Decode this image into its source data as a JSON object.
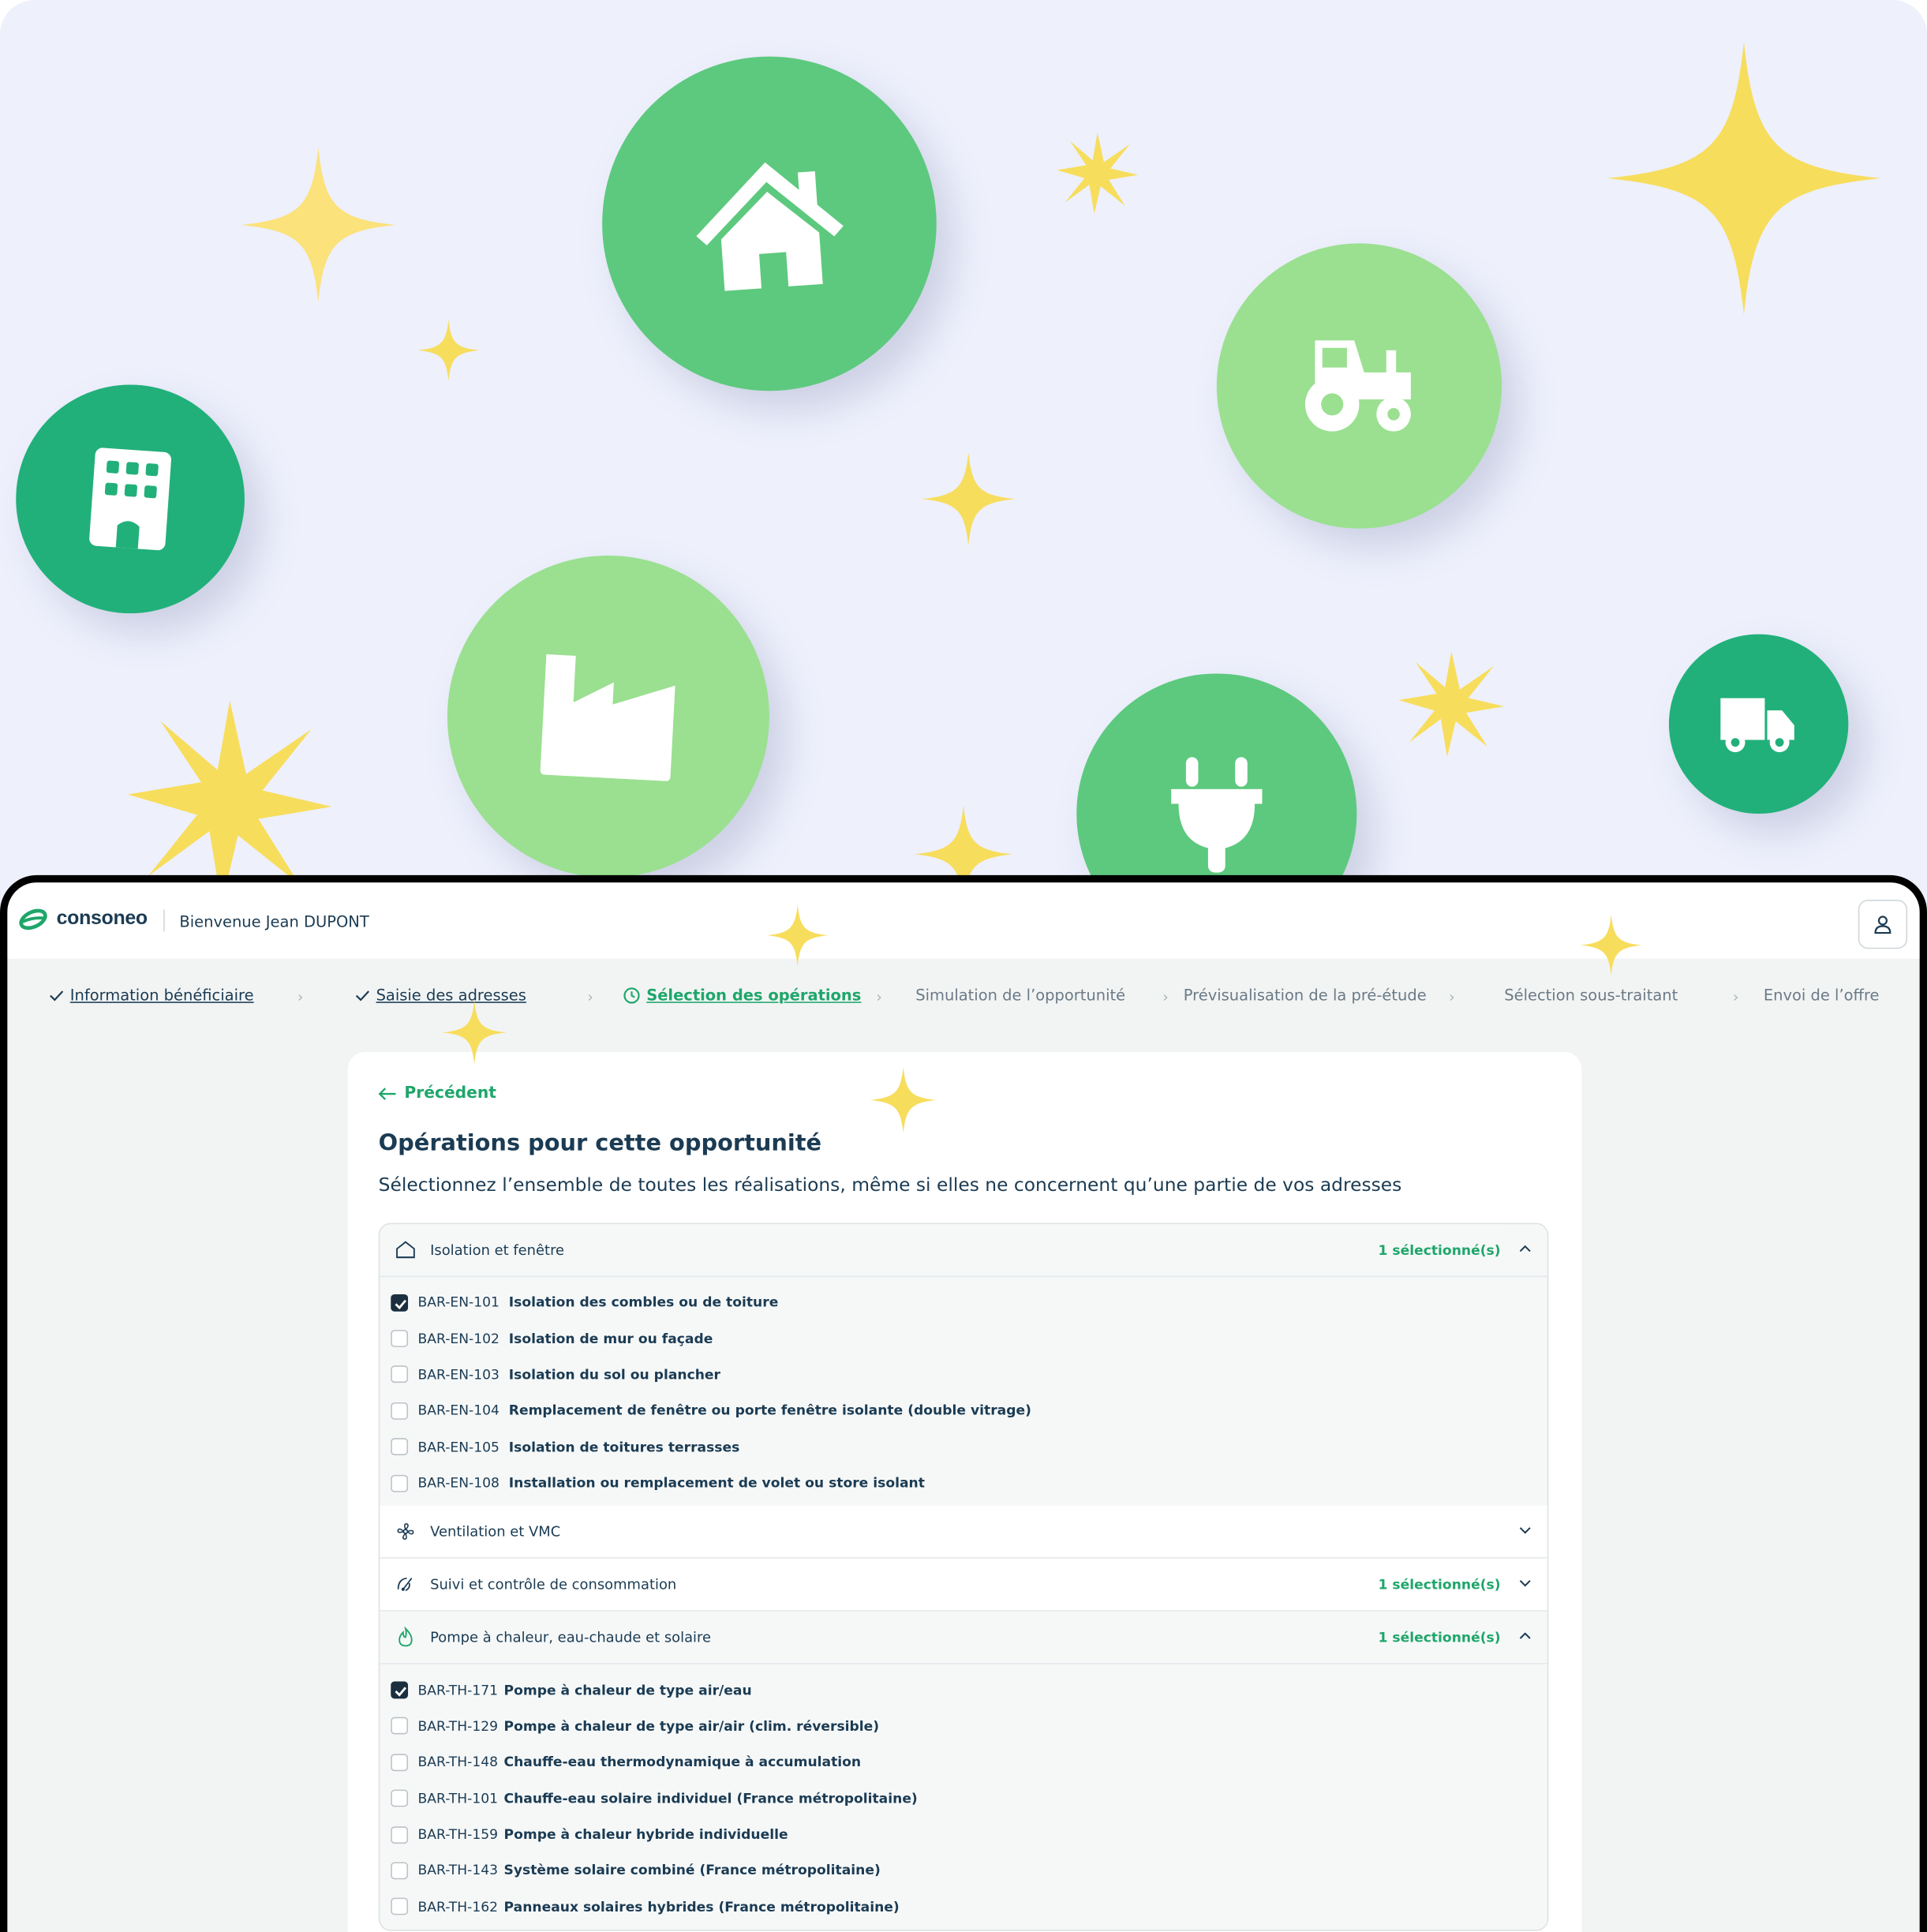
{
  "colors": {
    "brand": "#1fa66a",
    "navy": "#1b3b53",
    "bubble_dark": "#22b07a",
    "bubble_mid": "#5dc97e",
    "bubble_light": "#9ae090",
    "star": "#f7dd5c"
  },
  "hero": {
    "icons": [
      "building-icon",
      "house-icon",
      "tractor-icon",
      "factory-icon",
      "plug-icon",
      "truck-icon"
    ]
  },
  "header": {
    "logo_text": "consoneo",
    "welcome": "Bienvenue Jean DUPONT",
    "user_icon": "user-icon"
  },
  "steps": [
    {
      "label": "Information bénéficiaire",
      "state": "done"
    },
    {
      "label": "Saisie des adresses",
      "state": "done"
    },
    {
      "label": "Sélection des opérations",
      "state": "active"
    },
    {
      "label": "Simulation de l’opportunité",
      "state": "todo"
    },
    {
      "label": "Prévisualisation de la pré-étude",
      "state": "todo"
    },
    {
      "label": "Sélection sous-traitant",
      "state": "todo"
    },
    {
      "label": "Envoi de l’offre",
      "state": "todo"
    }
  ],
  "page": {
    "back_label": "Précédent",
    "title": "Opérations pour cette opportunité",
    "subtitle": "Sélectionnez l’ensemble de toutes les réalisations, même si elles ne concernent qu’une partie de vos adresses"
  },
  "sections": [
    {
      "title": "Isolation et fenêtre",
      "icon": "house-outline-icon",
      "count": "1 sélectionné(s)",
      "expanded": true,
      "operations": [
        {
          "code": "BAR-EN-101",
          "label": "Isolation des combles ou de toiture",
          "checked": true
        },
        {
          "code": "BAR-EN-102",
          "label": "Isolation de mur ou façade",
          "checked": false
        },
        {
          "code": "BAR-EN-103",
          "label": "Isolation du sol ou plancher",
          "checked": false
        },
        {
          "code": "BAR-EN-104",
          "label": "Remplacement de fenêtre ou porte fenêtre isolante (double vitrage)",
          "checked": false
        },
        {
          "code": "BAR-EN-105",
          "label": "Isolation de toitures terrasses",
          "checked": false
        },
        {
          "code": "BAR-EN-108",
          "label": "Installation ou remplacement de volet ou store isolant",
          "checked": false
        }
      ]
    },
    {
      "title": "Ventilation et VMC",
      "icon": "fan-icon",
      "count": "",
      "expanded": false,
      "operations": []
    },
    {
      "title": "Suivi et contrôle de consommation",
      "icon": "gauge-icon",
      "count": "1 sélectionné(s)",
      "expanded": false,
      "operations": []
    },
    {
      "title": "Pompe à chaleur, eau-chaude et solaire",
      "icon": "flame-icon",
      "count": "1 sélectionné(s)",
      "expanded": true,
      "operations": [
        {
          "code": "BAR-TH-171",
          "label": "Pompe à chaleur de type air/eau",
          "checked": true
        },
        {
          "code": "BAR-TH-129",
          "label": "Pompe à chaleur de type air/air (clim. réversible)",
          "checked": false
        },
        {
          "code": "BAR-TH-148",
          "label": "Chauffe-eau thermodynamique à accumulation",
          "checked": false
        },
        {
          "code": "BAR-TH-101",
          "label": "Chauffe-eau solaire individuel (France métropolitaine)",
          "checked": false
        },
        {
          "code": "BAR-TH-159",
          "label": "Pompe à chaleur hybride individuelle",
          "checked": false
        },
        {
          "code": "BAR-TH-143",
          "label": "Système solaire combiné (France métropolitaine)",
          "checked": false
        },
        {
          "code": "BAR-TH-162",
          "label": "Panneaux solaires hybrides (France métropolitaine)",
          "checked": false
        }
      ]
    }
  ]
}
